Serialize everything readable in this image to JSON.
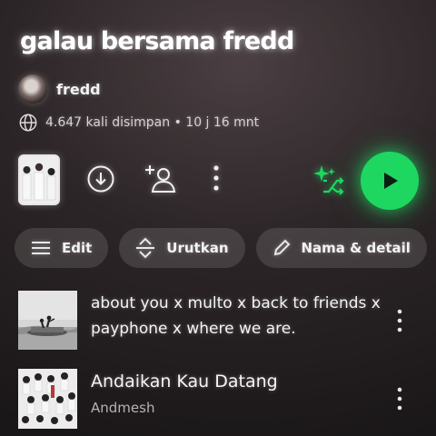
{
  "playlist": {
    "title": "galau bersama fredd",
    "owner": "fredd",
    "meta": "4.647 kali disimpan • 10 j 16 mnt"
  },
  "actions": {
    "cover_icon": "playlist-cover-thumbnail",
    "download_icon": "download-icon",
    "add_user_icon": "add-user-icon",
    "more_icon": "more-vertical-icon",
    "shuffle_icon": "smart-shuffle-icon",
    "play_icon": "play-icon"
  },
  "chips": [
    {
      "label": "Edit",
      "icon": "edit-lines-icon"
    },
    {
      "label": "Urutkan",
      "icon": "sort-icon"
    },
    {
      "label": "Nama & detail",
      "icon": "pencil-icon"
    }
  ],
  "tracks": [
    {
      "title": "about you x multo x back to friends x payphone x where we are.",
      "artist": ""
    },
    {
      "title": "Andaikan Kau Datang",
      "artist": "Andmesh"
    }
  ],
  "colors": {
    "accent": "#1ed760",
    "background": "#2c2527"
  }
}
